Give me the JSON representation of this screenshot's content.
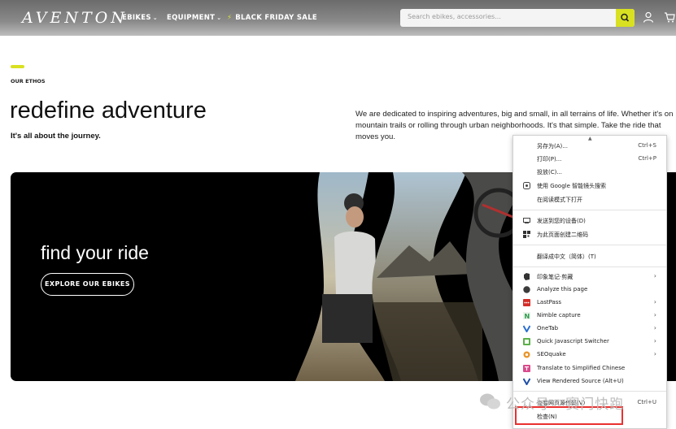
{
  "header": {
    "logo": "AVENTON",
    "nav": [
      {
        "label": "EBIKES",
        "has_dropdown": true
      },
      {
        "label": "EQUIPMENT",
        "has_dropdown": true
      },
      {
        "label": "BLACK FRIDAY SALE",
        "icon": "lightning-icon"
      }
    ],
    "search_placeholder": "Search ebikes, accessories...",
    "icons": [
      "search-icon",
      "user-icon",
      "cart-icon"
    ]
  },
  "ethos": {
    "eyebrow": "OUR ETHOS",
    "headline": "redefine adventure",
    "subhead": "It's all about the journey.",
    "paragraph_lines": [
      "We are dedicated to inspiring adventures, big and small, in all terrains of life. Whether it's on",
      "mountain trails or rolling through urban neighborhoods. It's that simple. Take the ride that",
      "moves you."
    ]
  },
  "hero": {
    "title": "find your ride",
    "cta": "EXPLORE OUR EBIKES"
  },
  "context_menu": {
    "items": [
      {
        "label": "另存为(A)...",
        "shortcut": "Ctrl+S"
      },
      {
        "label": "打印(P)...",
        "shortcut": "Ctrl+P"
      },
      {
        "label": "投放(C)..."
      },
      {
        "label": "使用 Google 智能镜头搜索",
        "icon": "lens-icon"
      },
      {
        "label": "在阅读模式下打开"
      },
      {
        "label": "发送到您的设备(D)",
        "icon": "device-icon"
      },
      {
        "label": "为此页面创建二维码",
        "icon": "qr-icon"
      },
      {
        "label": "翻译成中文（简体）(T)"
      },
      {
        "label": "印象笔记·剪藏",
        "icon": "evernote-icon",
        "submenu": true
      },
      {
        "label": "Analyze this page",
        "icon": "analyze-icon"
      },
      {
        "label": "LastPass",
        "icon": "lastpass-icon",
        "submenu": true
      },
      {
        "label": "Nimble capture",
        "icon": "nimble-icon",
        "submenu": true
      },
      {
        "label": "OneTab",
        "icon": "onetab-icon",
        "submenu": true
      },
      {
        "label": "Quick Javascript Switcher",
        "icon": "js-switcher-icon",
        "submenu": true
      },
      {
        "label": "SEOquake",
        "icon": "seoquake-icon",
        "submenu": true
      },
      {
        "label": "Translate to Simplified Chinese",
        "icon": "translate-icon"
      },
      {
        "label": "View Rendered Source (Alt+U)",
        "icon": "view-source-icon"
      },
      {
        "label": "查看网页源代码(V)",
        "shortcut": "Ctrl+U"
      },
      {
        "label": "检查(N)"
      }
    ]
  },
  "watermark": "公众号 · 赛门快跑",
  "colors": {
    "accent": "#d9e021",
    "highlight": "#e8312f"
  }
}
